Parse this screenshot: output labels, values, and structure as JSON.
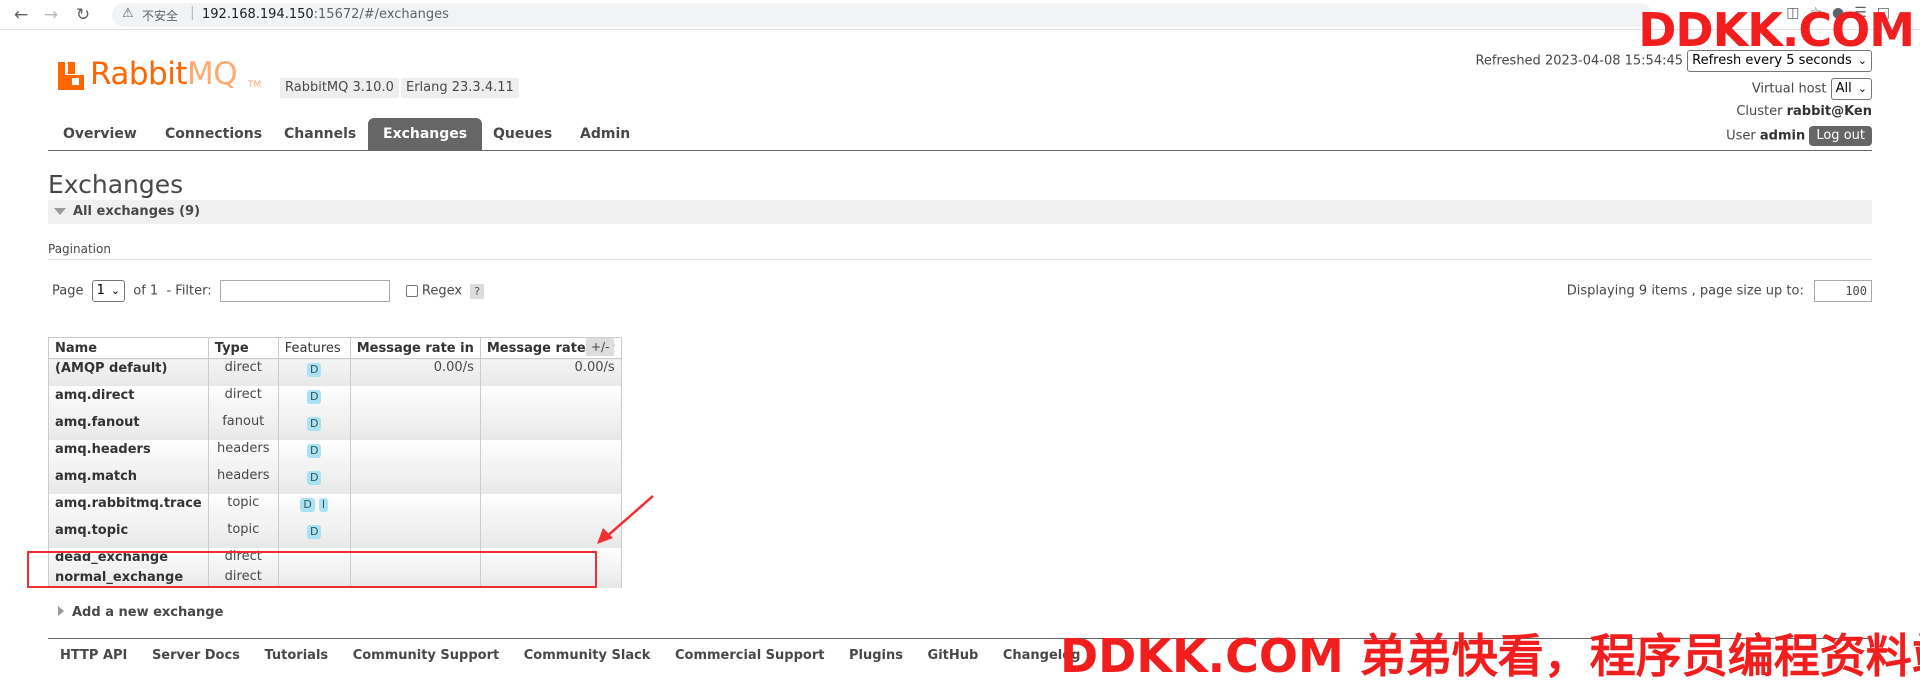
{
  "browser": {
    "insecure_label": "不安全",
    "url_host": "192.168.194.150",
    "url_rest": ":15672/#/exchanges"
  },
  "watermark": {
    "top": "DDKK.COM",
    "bottom": "DDKK.COM 弟弟快看，程序员编程资料站"
  },
  "header": {
    "logo_text_rabbit": "Rabbit",
    "logo_text_mq": "MQ",
    "logo_tm": "TM",
    "rabbitmq_version": "RabbitMQ 3.10.0",
    "erlang_version": "Erlang 23.3.4.11",
    "refreshed_label": "Refreshed 2023-04-08 15:54:45",
    "refresh_select": "Refresh every 5 seconds",
    "virtual_host_label": "Virtual host",
    "virtual_host_select": "All",
    "cluster_label": "Cluster",
    "cluster_value": "rabbit@Ken",
    "user_label": "User",
    "user_value": "admin",
    "logout_label": "Log out"
  },
  "tabs": [
    "Overview",
    "Connections",
    "Channels",
    "Exchanges",
    "Queues",
    "Admin"
  ],
  "active_tab": "Exchanges",
  "page": {
    "title": "Exchanges",
    "section_label": "All exchanges (9)",
    "pagination_label": "Pagination",
    "page_label": "Page",
    "page_select": "1",
    "of_label": "of 1",
    "filter_label": "- Filter:",
    "regex_label": "Regex",
    "help_label": "?",
    "displaying_label": "Displaying 9 items , page size up to:",
    "page_size": "100"
  },
  "table": {
    "columns": [
      "Name",
      "Type",
      "Features",
      "Message rate in",
      "Message rate out"
    ],
    "toggle_label": "+/-",
    "rows": [
      {
        "name": "(AMQP default)",
        "type": "direct",
        "features": [
          "D"
        ],
        "rate_in": "0.00/s",
        "rate_out": "0.00/s"
      },
      {
        "name": "amq.direct",
        "type": "direct",
        "features": [
          "D"
        ],
        "rate_in": "",
        "rate_out": ""
      },
      {
        "name": "amq.fanout",
        "type": "fanout",
        "features": [
          "D"
        ],
        "rate_in": "",
        "rate_out": ""
      },
      {
        "name": "amq.headers",
        "type": "headers",
        "features": [
          "D"
        ],
        "rate_in": "",
        "rate_out": ""
      },
      {
        "name": "amq.match",
        "type": "headers",
        "features": [
          "D"
        ],
        "rate_in": "",
        "rate_out": ""
      },
      {
        "name": "amq.rabbitmq.trace",
        "type": "topic",
        "features": [
          "D",
          "I"
        ],
        "rate_in": "",
        "rate_out": ""
      },
      {
        "name": "amq.topic",
        "type": "topic",
        "features": [
          "D"
        ],
        "rate_in": "",
        "rate_out": ""
      },
      {
        "name": "dead_exchange",
        "type": "direct",
        "features": [],
        "rate_in": "",
        "rate_out": ""
      },
      {
        "name": "normal_exchange",
        "type": "direct",
        "features": [],
        "rate_in": "",
        "rate_out": ""
      }
    ]
  },
  "add_new_label": "Add a new exchange",
  "footer": [
    "HTTP API",
    "Server Docs",
    "Tutorials",
    "Community Support",
    "Community Slack",
    "Commercial Support",
    "Plugins",
    "GitHub",
    "Changelog"
  ],
  "colors": {
    "brand": "#ff6600",
    "tab_active": "#666666",
    "feature_badge": "#a8e2f4",
    "annotation": "#f03030",
    "watermark": "#f21d1d"
  }
}
